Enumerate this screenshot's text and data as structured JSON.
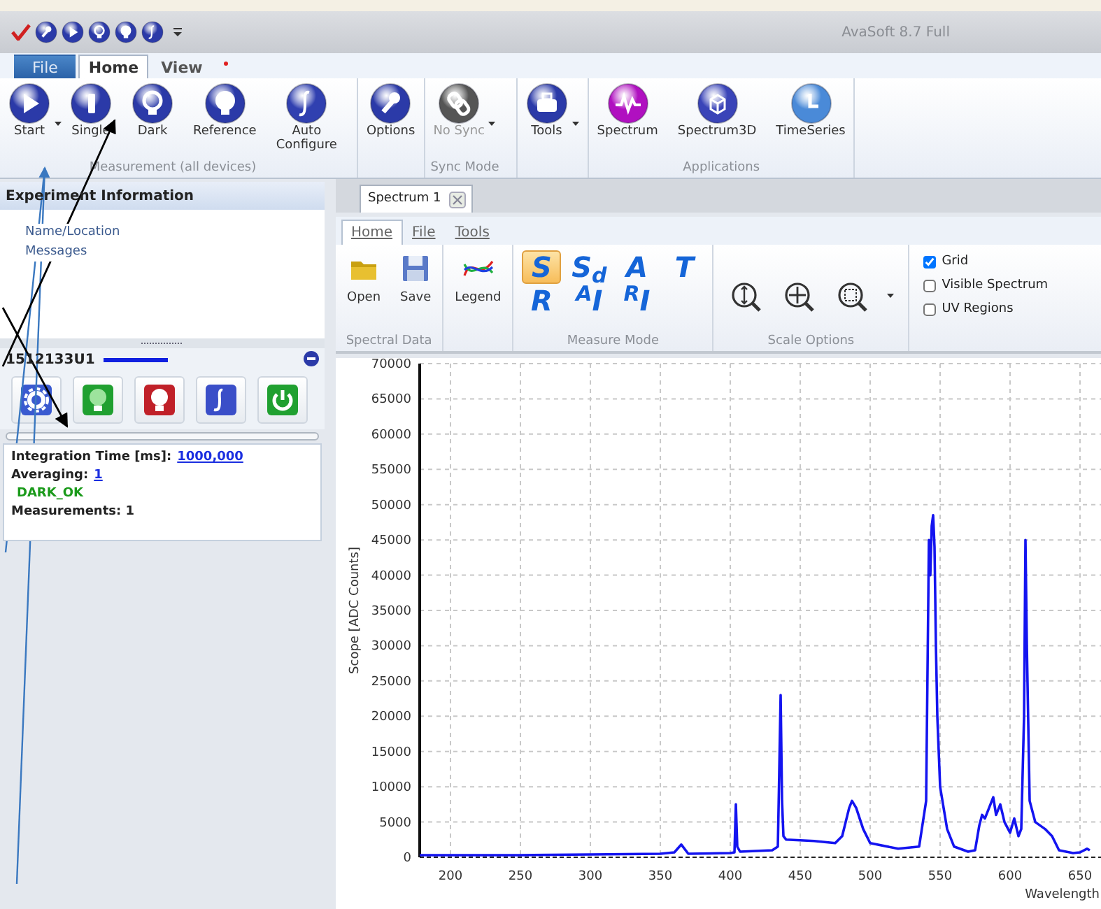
{
  "title_bar": {
    "title": "AvaSoft 8.7 Full"
  },
  "ribbon_tabs": [
    {
      "label": "File",
      "selected": false,
      "kind": "file"
    },
    {
      "label": "Home",
      "selected": true,
      "kind": "tab"
    },
    {
      "label": "View",
      "selected": false,
      "kind": "tab"
    }
  ],
  "ribbon_groups": [
    {
      "label": "Measurement (all devices)",
      "buttons": [
        {
          "label": "Start",
          "dropdown": true,
          "disabled": false
        },
        {
          "label": "Single",
          "dropdown": false,
          "disabled": false
        },
        {
          "label": "Dark",
          "dropdown": false,
          "disabled": false
        },
        {
          "label": "Reference",
          "dropdown": false,
          "disabled": false
        },
        {
          "label": "Auto\nConfigure",
          "dropdown": false,
          "disabled": false
        }
      ]
    },
    {
      "buttons": [
        {
          "label": "Options",
          "dropdown": false,
          "disabled": false
        }
      ]
    },
    {
      "label": "Sync Mode",
      "buttons": [
        {
          "label": "No Sync",
          "dropdown": true,
          "disabled": true
        }
      ]
    },
    {
      "buttons": [
        {
          "label": "Tools",
          "dropdown": true,
          "disabled": false
        }
      ]
    },
    {
      "label": "Applications",
      "buttons": [
        {
          "label": "Spectrum",
          "dropdown": false,
          "disabled": false
        },
        {
          "label": "Spectrum3D",
          "dropdown": false,
          "disabled": false
        },
        {
          "label": "TimeSeries",
          "dropdown": false,
          "disabled": false
        }
      ]
    }
  ],
  "experiment_information": {
    "title": "Experiment Information",
    "items": [
      "Name/Location",
      "Messages"
    ]
  },
  "device_panel": {
    "serial": "1512133U1",
    "integration_label": "Integration Time  [ms]:",
    "integration_value": "1000,000",
    "averaging_label": "Averaging:",
    "averaging_value": "1",
    "status": "DARK_OK",
    "measurements": "Measurements: 1"
  },
  "document_tabs": [
    {
      "label": "Spectrum 1",
      "selected": true
    }
  ],
  "spectrum_tabs": [
    {
      "label": "Home",
      "selected": true
    },
    {
      "label": "File",
      "selected": false
    },
    {
      "label": "Tools",
      "selected": false
    }
  ],
  "spectral_data": {
    "label": "Spectral Data",
    "buttons": [
      "Open",
      "Save"
    ]
  },
  "legend_button": "Legend",
  "measure_mode": {
    "label": "Measure Mode",
    "modes": [
      {
        "label": "S",
        "selected": true
      },
      {
        "label": "S$_{d}$",
        "selected": false
      },
      {
        "label": "A",
        "selected": false
      },
      {
        "label": "T",
        "selected": false
      },
      {
        "label": "R",
        "selected": false
      },
      {
        "label": "$^{A}$I",
        "selected": false
      },
      {
        "label": "$^{R}$I",
        "selected": false
      }
    ]
  },
  "scale_options": {
    "label": "Scale Options"
  },
  "view_options": [
    {
      "label": "Grid",
      "checked": true
    },
    {
      "label": "Visible Spectrum",
      "checked": false
    },
    {
      "label": "UV Regions",
      "checked": false
    }
  ],
  "chart": {
    "chart_data": {
      "type": "line",
      "xlabel": "Wavelength",
      "ylabel": "Scope [ADC Counts]",
      "x": [
        178,
        200,
        250,
        300,
        350,
        360,
        365,
        370,
        400,
        403,
        404,
        405,
        407,
        430,
        434,
        435,
        436,
        437,
        438,
        440,
        460,
        475,
        480,
        485,
        487,
        490,
        495,
        500,
        520,
        535,
        540,
        542,
        543,
        544,
        545,
        546,
        547,
        548,
        550,
        555,
        560,
        570,
        575,
        578,
        580,
        582,
        585,
        588,
        590,
        593,
        596,
        600,
        603,
        606,
        608,
        610,
        611,
        612,
        614,
        618,
        625,
        630,
        635,
        640,
        645,
        650,
        655,
        657
      ],
      "series": [
        {
          "color": "#1414f0",
          "values": [
            300,
            300,
            300,
            400,
            500,
            700,
            1800,
            500,
            600,
            700,
            7500,
            1500,
            800,
            1000,
            1500,
            12000,
            23000,
            8000,
            3000,
            2500,
            2300,
            2000,
            3000,
            7000,
            8000,
            7000,
            4000,
            2000,
            1200,
            1500,
            8000,
            45000,
            40000,
            47000,
            48500,
            44000,
            30000,
            20000,
            10000,
            4000,
            1500,
            800,
            1000,
            4500,
            6000,
            5500,
            7000,
            8500,
            6000,
            7500,
            5000,
            3500,
            5500,
            3000,
            4000,
            20000,
            45000,
            30000,
            8000,
            5000,
            4000,
            3000,
            1000,
            800,
            600,
            700,
            1200,
            1000
          ]
        }
      ],
      "xlim": [
        178,
        665
      ],
      "ylim": [
        0,
        70000
      ],
      "grid": true,
      "xticks": [
        200,
        250,
        300,
        350,
        400,
        450,
        500,
        550,
        600,
        650
      ],
      "yticks": [
        0,
        5000,
        10000,
        15000,
        20000,
        25000,
        30000,
        35000,
        40000,
        45000,
        50000,
        55000,
        60000,
        65000,
        70000
      ]
    }
  }
}
